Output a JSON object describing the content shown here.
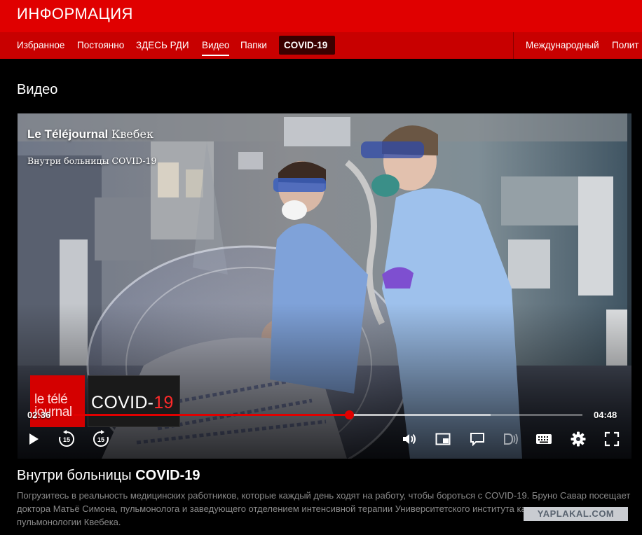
{
  "header": {
    "brand": "ИНФОРМАЦИЯ"
  },
  "nav": {
    "items": [
      {
        "label": "Избранное"
      },
      {
        "label": "Постоянно"
      },
      {
        "label": "ЗДЕСЬ РДИ"
      },
      {
        "label": "Видео",
        "active": true
      },
      {
        "label": "Папки"
      },
      {
        "label": "COVID-19",
        "highlight": true
      },
      {
        "label": "Международный"
      },
      {
        "label": "Полит"
      }
    ]
  },
  "section": {
    "title": "Видео"
  },
  "player": {
    "show_name": "Le Téléjournal",
    "show_city": "Квебек",
    "episode_subtitle": "Внутри больницы COVID-19",
    "logo_text": "le télé journal",
    "badge_text": "COVID-",
    "badge_number": "19",
    "current_time": "02:36",
    "total_time": "04:48",
    "progress_fraction": 0.542,
    "buffered_fraction": 0.82,
    "icons": {
      "play": "play-icon",
      "rewind": "rewind-15-icon",
      "forward": "forward-15-icon",
      "volume": "volume-icon",
      "pip": "picture-in-picture-icon",
      "captions": "captions-icon",
      "audio_description": "audio-description-icon",
      "keyboard": "keyboard-icon",
      "settings": "gear-icon",
      "fullscreen": "fullscreen-icon"
    },
    "skip_seconds": "15",
    "accent_color": "#e00000"
  },
  "video": {
    "title_prefix": "Внутри больницы",
    "title_bold": "COVID-19",
    "description": "Погрузитесь в реальность медицинских работников, которые каждый день ходят на работу, чтобы бороться с COVID-19. Бруно Савар посещает доктора Матьё Симона, пульмонолога и заведующего отделением интенсивной терапии Университетского института кардиологии и пульмонологии Квебека."
  },
  "watermark": {
    "text": "YAPLAKAL.COM"
  },
  "colors": {
    "brand_red": "#e00000",
    "nav_red": "#c80000",
    "background": "#000000"
  }
}
